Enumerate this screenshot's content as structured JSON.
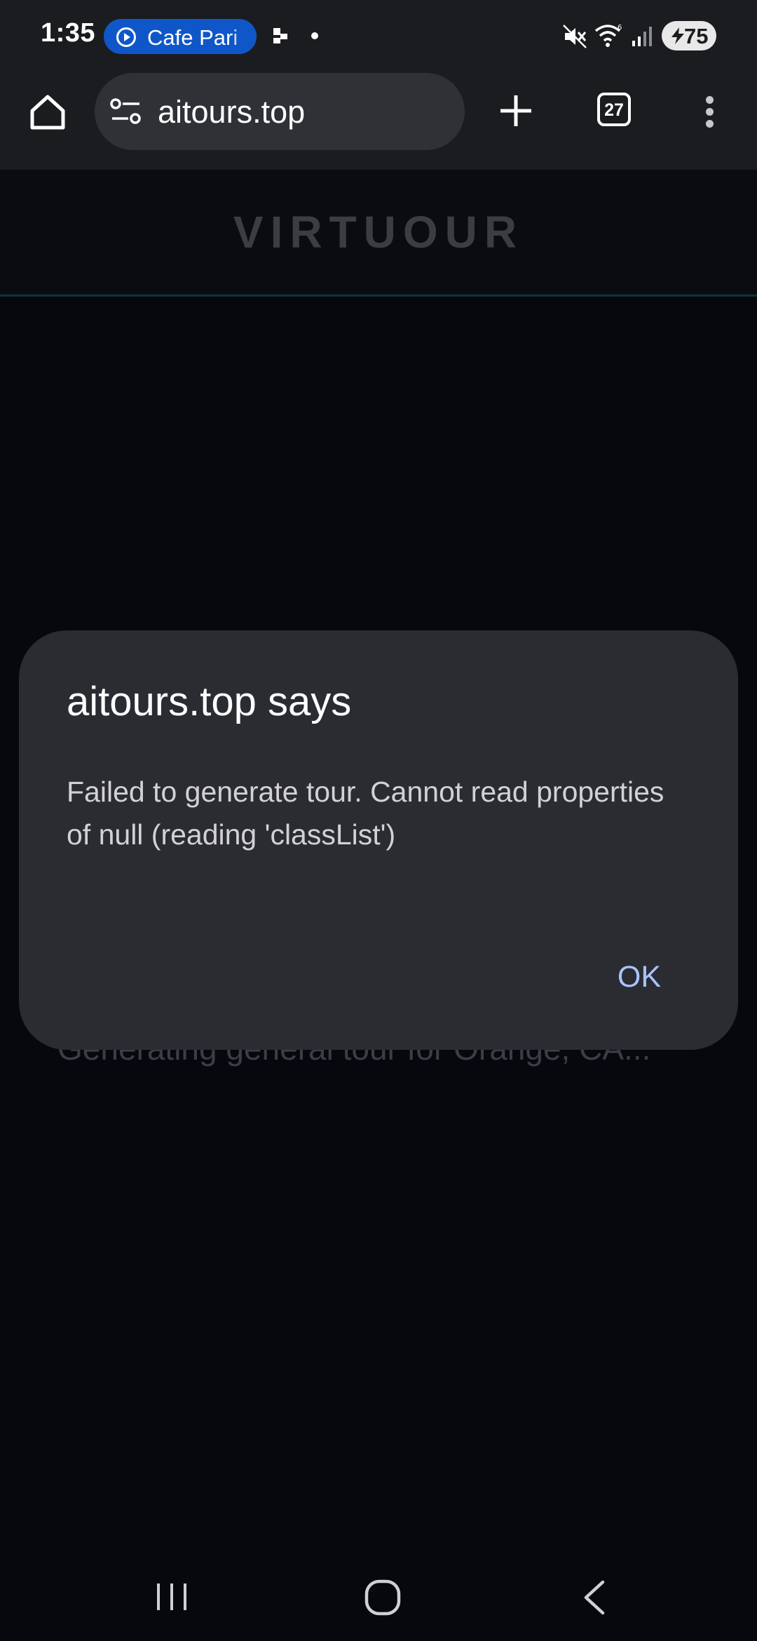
{
  "status_bar": {
    "time": "1:35",
    "media_label": "Cafe Pari",
    "battery_level": "75",
    "icons": [
      "notification-icon",
      "dot-icon",
      "mute-icon",
      "wifi-icon",
      "signal-icon",
      "battery-icon"
    ]
  },
  "toolbar": {
    "url": "aitours.top",
    "tab_count": "27",
    "icons": [
      "home-icon",
      "tune-icon",
      "plus-icon",
      "tabs-icon",
      "more-vert-icon"
    ]
  },
  "page": {
    "logo": "VIRTUOUR",
    "loading_message": "Generating general tour for Orange, CA..."
  },
  "dialog": {
    "title": "aitours.top says",
    "message": "Failed to generate tour. Cannot read properties of null (reading 'classList')",
    "ok_label": "OK"
  },
  "colors": {
    "background": "#06080e",
    "toolbar": "#1b1c20",
    "dialog": "#2b2c31",
    "accent": "#a8c4ff",
    "media_pill": "#0f57c8"
  }
}
